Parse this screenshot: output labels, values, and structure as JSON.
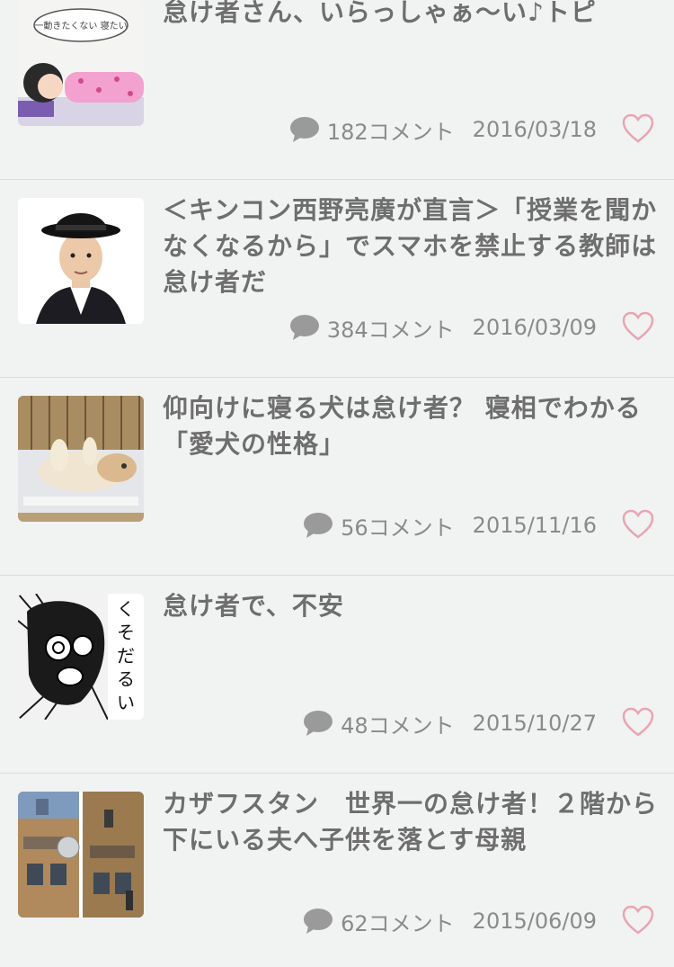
{
  "articles": [
    {
      "title": "怠け者さん、いらっしゃぁ〜い♪トピ",
      "comments": "182コメント",
      "date": "2016/03/18",
      "thumb": "lazy-girl-cartoon"
    },
    {
      "title": "＜キンコン西野亮廣が直言＞「授業を聞かなくなるから」でスマホを禁止する教師は怠け者だ",
      "comments": "384コメント",
      "date": "2016/03/09",
      "thumb": "man-in-hat-portrait"
    },
    {
      "title": "仰向けに寝る犬は怠け者？ 寝相でわかる「愛犬の性格」",
      "comments": "56コメント",
      "date": "2015/11/16",
      "thumb": "dog-sleeping-on-back"
    },
    {
      "title": "怠け者で、不安",
      "comments": "48コメント",
      "date": "2015/10/27",
      "thumb": "manga-panel-kusodarui"
    },
    {
      "title": "カザフスタン　世界一の怠け者！２階から下にいる夫へ子供を落とす母親",
      "comments": "62コメント",
      "date": "2015/06/09",
      "thumb": "apartment-building-photo"
    }
  ],
  "manga_text": "くそだるい",
  "cartoon_text": "一動きたくない 寝たい",
  "colors": {
    "title": "#6e6e6e",
    "meta": "#8a8a8a",
    "heart": "#e8a5b3",
    "background": "#f1f2f2"
  }
}
